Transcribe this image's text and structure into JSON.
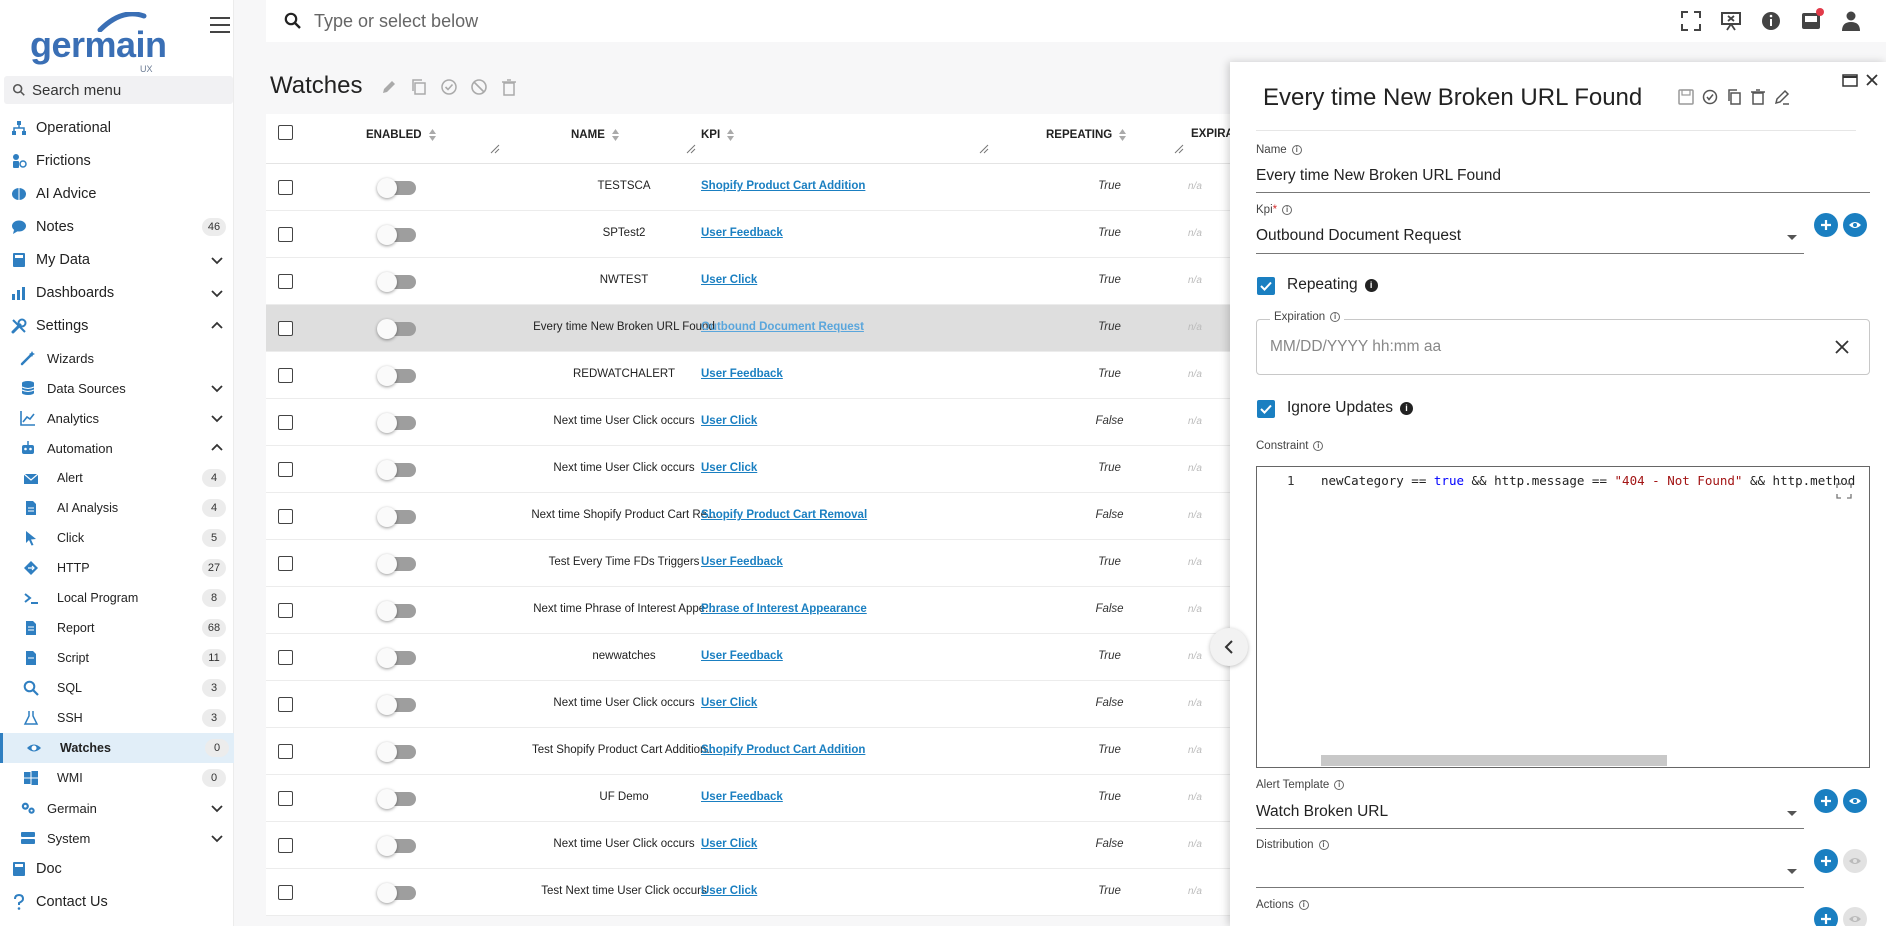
{
  "sidebar": {
    "logo_text": "germain",
    "logo_sub": "UX",
    "search_placeholder": "Search menu",
    "items": [
      {
        "label": "Operational",
        "icon": "sitemap-icon"
      },
      {
        "label": "Frictions",
        "icon": "frictions-icon"
      },
      {
        "label": "AI Advice",
        "icon": "brain-icon"
      },
      {
        "label": "Notes",
        "icon": "comment-icon",
        "badge": "46"
      },
      {
        "label": "My Data",
        "icon": "book-icon"
      },
      {
        "label": "Dashboards",
        "icon": "chart-icon"
      },
      {
        "label": "Settings",
        "icon": "wrench-icon"
      },
      {
        "label": "Wizards",
        "icon": "wand-icon"
      },
      {
        "label": "Data Sources",
        "icon": "database-icon"
      },
      {
        "label": "Analytics",
        "icon": "line-chart-icon"
      },
      {
        "label": "Automation",
        "icon": "robot-icon"
      },
      {
        "label": "Alert",
        "icon": "envelope-icon",
        "badge": "4"
      },
      {
        "label": "AI Analysis",
        "icon": "file-icon",
        "badge": "4"
      },
      {
        "label": "Click",
        "icon": "pointer-icon",
        "badge": "5"
      },
      {
        "label": "HTTP",
        "icon": "diamond-icon",
        "badge": "27"
      },
      {
        "label": "Local Program",
        "icon": "terminal-icon",
        "badge": "8"
      },
      {
        "label": "Report",
        "icon": "report-icon",
        "badge": "68"
      },
      {
        "label": "Script",
        "icon": "script-icon",
        "badge": "11"
      },
      {
        "label": "SQL",
        "icon": "search-icon",
        "badge": "3"
      },
      {
        "label": "SSH",
        "icon": "flask-icon",
        "badge": "3"
      },
      {
        "label": "Watches",
        "icon": "eye-icon",
        "badge": "0"
      },
      {
        "label": "WMI",
        "icon": "windows-icon",
        "badge": "0"
      },
      {
        "label": "Germain",
        "icon": "gears-icon"
      },
      {
        "label": "System",
        "icon": "server-icon"
      },
      {
        "label": "Doc",
        "icon": "doc-icon"
      },
      {
        "label": "Contact Us",
        "icon": "question-icon"
      }
    ]
  },
  "topbar": {
    "search_placeholder": "Type or select below"
  },
  "page": {
    "title": "Watches"
  },
  "table": {
    "headers": {
      "enabled": "ENABLED",
      "name": "NAME",
      "kpi": "KPI",
      "repeating": "REPEATING",
      "expiration": "EXPIRA"
    },
    "rows": [
      {
        "name": "TESTSCA",
        "kpi": "Shopify Product Cart Addition",
        "repeating": "True",
        "expiration": "n/a"
      },
      {
        "name": "SPTest2",
        "kpi": "User Feedback",
        "repeating": "True",
        "expiration": "n/a"
      },
      {
        "name": "NWTEST",
        "kpi": "User Click",
        "repeating": "True",
        "expiration": "n/a"
      },
      {
        "name": "Every time New Broken URL Found",
        "kpi": "Outbound Document Request",
        "repeating": "True",
        "expiration": "n/a",
        "selected": true
      },
      {
        "name": "REDWATCHALERT",
        "kpi": "User Feedback",
        "repeating": "True",
        "expiration": "n/a"
      },
      {
        "name": "Next time User Click occurs",
        "kpi": "User Click",
        "repeating": "False",
        "expiration": "n/a"
      },
      {
        "name": "Next time User Click occurs",
        "kpi": "User Click",
        "repeating": "True",
        "expiration": "n/a"
      },
      {
        "name": "Next time Shopify Product Cart Re...",
        "kpi": "Shopify Product Cart Removal",
        "repeating": "False",
        "expiration": "n/a"
      },
      {
        "name": "Test Every Time FDs Triggers",
        "kpi": "User Feedback",
        "repeating": "True",
        "expiration": "n/a"
      },
      {
        "name": "Next time Phrase of Interest Appe...",
        "kpi": "Phrase of Interest Appearance",
        "repeating": "False",
        "expiration": "n/a"
      },
      {
        "name": "newwatches",
        "kpi": "User Feedback",
        "repeating": "True",
        "expiration": "n/a"
      },
      {
        "name": "Next time User Click occurs",
        "kpi": "User Click",
        "repeating": "False",
        "expiration": "n/a"
      },
      {
        "name": "Test Shopify Product Cart Addition...",
        "kpi": "Shopify Product Cart Addition",
        "repeating": "True",
        "expiration": "n/a"
      },
      {
        "name": "UF Demo",
        "kpi": "User Feedback",
        "repeating": "True",
        "expiration": "n/a"
      },
      {
        "name": "Next time User Click occurs",
        "kpi": "User Click",
        "repeating": "False",
        "expiration": "n/a"
      },
      {
        "name": "Test Next time User Click occurs",
        "kpi": "User Click",
        "repeating": "True",
        "expiration": "n/a"
      }
    ]
  },
  "panel": {
    "title": "Every time New Broken URL Found",
    "name_label": "Name",
    "name_value": "Every time New Broken URL Found",
    "kpi_label": "Kpi",
    "kpi_required": "*",
    "kpi_value": "Outbound Document Request",
    "repeating_label": "Repeating",
    "expiration_label": "Expiration",
    "expiration_placeholder": "MM/DD/YYYY hh:mm aa",
    "ignore_updates_label": "Ignore Updates",
    "constraint_label": "Constraint",
    "constraint_line_no": "1",
    "constraint_code": {
      "p1": "newCategory == ",
      "kw": "true",
      "p2": " && http.message == ",
      "str": "\"404 - Not Found\"",
      "p3": " && http.method"
    },
    "alert_template_label": "Alert Template",
    "alert_template_value": "Watch Broken URL",
    "distribution_label": "Distribution",
    "actions_label": "Actions",
    "info_glyph": "i"
  },
  "colors": {
    "accent": "#1a7fc1",
    "brand": "#3a6fb5",
    "active_bg": "#e1eef8",
    "notification": "#e23b4a"
  }
}
